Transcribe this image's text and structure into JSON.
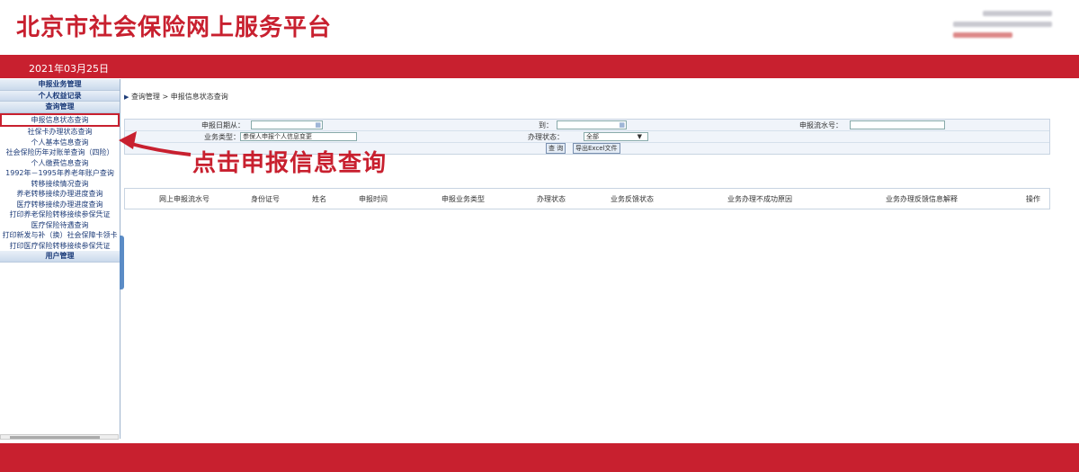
{
  "header": {
    "title": "北京市社会保险网上服务平台"
  },
  "topbar": {
    "date": "2021年03月25日"
  },
  "sidebar": {
    "items": [
      {
        "label": "申报业务管理",
        "type": "head"
      },
      {
        "label": "个人权益记录",
        "type": "head"
      },
      {
        "label": "查询管理",
        "type": "head"
      },
      {
        "label": "申报信息状态查询",
        "type": "active"
      },
      {
        "label": "社保卡办理状态查询",
        "type": "item"
      },
      {
        "label": "个人基本信息查询",
        "type": "item"
      },
      {
        "label": "社会保险历年对账单查询（四险）",
        "type": "item"
      },
      {
        "label": "个人缴费信息查询",
        "type": "item"
      },
      {
        "label": "1992年－1995年养老年账户查询",
        "type": "item"
      },
      {
        "label": "转移接续情况查询",
        "type": "item"
      },
      {
        "label": "养老转移接续办理进度查询",
        "type": "item"
      },
      {
        "label": "医疗转移接续办理进度查询",
        "type": "item"
      },
      {
        "label": "打印养老保险转移接续参保凭证",
        "type": "item"
      },
      {
        "label": "医疗保险待遇查询",
        "type": "item"
      },
      {
        "label": "打印新发与补（换）社会保障卡领卡",
        "type": "item"
      },
      {
        "label": "打印医疗保险转移接续参保凭证",
        "type": "item"
      },
      {
        "label": "用户管理",
        "type": "head"
      }
    ]
  },
  "breadcrumb": "查询管理 > 申报信息状态查询",
  "form": {
    "date_from_label": "申报日期从：",
    "date_to_label": "到：",
    "serial_label": "申报流水号：",
    "biz_type_label": "业务类型：",
    "biz_type_value": "参保人申报个人信息变更",
    "status_label": "办理状态：",
    "status_value": "全部",
    "query_button": "查 询",
    "export_button": "导出Excel文件"
  },
  "table": {
    "columns": [
      "网上申报流水号",
      "身份证号",
      "姓名",
      "申报时间",
      "申报业务类型",
      "办理状态",
      "业务反馈状态",
      "业务办理不成功原因",
      "业务办理反馈信息解释",
      "操作"
    ]
  },
  "annotation": {
    "text": "点击申报信息查询"
  },
  "colors": {
    "brand_red": "#c8202f",
    "nav_blue": "#1e3c78"
  }
}
